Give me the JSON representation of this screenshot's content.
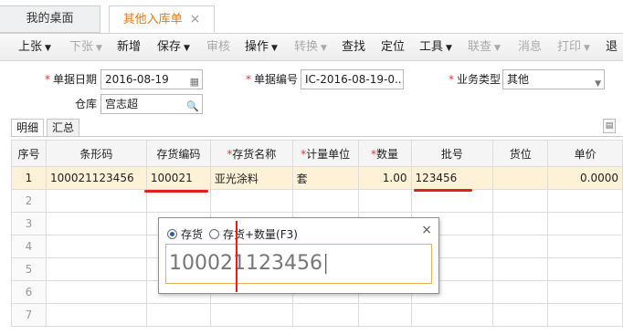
{
  "tabs": {
    "desk": "我的桌面",
    "active": "其他入库单",
    "close": "×"
  },
  "toolbar": {
    "items": [
      {
        "label": "上张",
        "dropdown": true,
        "disabled": false
      },
      {
        "label": "下张",
        "dropdown": true,
        "disabled": true
      },
      {
        "label": "新增",
        "dropdown": false,
        "disabled": false
      },
      {
        "label": "保存",
        "dropdown": true,
        "disabled": false
      },
      {
        "label": "审核",
        "dropdown": false,
        "disabled": true
      },
      {
        "label": "操作",
        "dropdown": true,
        "disabled": false
      },
      {
        "label": "转换",
        "dropdown": true,
        "disabled": true
      },
      {
        "label": "查找",
        "dropdown": false,
        "disabled": false
      },
      {
        "label": "定位",
        "dropdown": false,
        "disabled": false
      },
      {
        "label": "工具",
        "dropdown": true,
        "disabled": false
      },
      {
        "label": "联查",
        "dropdown": true,
        "disabled": true
      },
      {
        "label": "消息",
        "dropdown": false,
        "disabled": true
      },
      {
        "label": "打印",
        "dropdown": true,
        "disabled": true
      },
      {
        "label": "退",
        "dropdown": false,
        "disabled": false
      }
    ]
  },
  "form": {
    "date_label": "单据日期",
    "date_value": "2016-08-19",
    "number_label": "单据编号",
    "number_value": "IC-2016-08-19-0...",
    "type_label": "业务类型",
    "type_value": "其他",
    "warehouse_label": "仓库",
    "warehouse_value": "宫志超"
  },
  "subtabs": {
    "detail": "明细",
    "summary": "汇总"
  },
  "grid": {
    "columns": [
      "序号",
      "条形码",
      "存货编码",
      "存货名称",
      "计量单位",
      "数量",
      "批号",
      "货位",
      "单价"
    ],
    "required": [
      false,
      false,
      false,
      true,
      true,
      true,
      false,
      false,
      false
    ],
    "rows": [
      [
        "1",
        "100021123456",
        "100021",
        "亚光涂料",
        "套",
        "1.00",
        "123456",
        "",
        "0.0000"
      ],
      [
        "2",
        "",
        "",
        "",
        "",
        "",
        "",
        "",
        ""
      ],
      [
        "3",
        "",
        "",
        "",
        "",
        "",
        "",
        "",
        ""
      ],
      [
        "4",
        "",
        "",
        "",
        "",
        "",
        "",
        "",
        ""
      ],
      [
        "5",
        "",
        "",
        "",
        "",
        "",
        "",
        "",
        ""
      ],
      [
        "6",
        "",
        "",
        "",
        "",
        "",
        "",
        "",
        ""
      ],
      [
        "7",
        "",
        "",
        "",
        "",
        "",
        "",
        "",
        ""
      ]
    ]
  },
  "popup": {
    "option_inventory": "存货",
    "option_inventory_qty": "存货+数量(F3)",
    "selected": "存货",
    "input_value": "100021123456",
    "close": "×"
  },
  "colors": {
    "accent": "#e77817",
    "required": "#e33333",
    "annotation": "#e02020",
    "selected_row": "#fdf1d8"
  },
  "icons": {
    "date": "calendar-icon",
    "warehouse": "search-icon",
    "type": "chevron-down-icon"
  }
}
